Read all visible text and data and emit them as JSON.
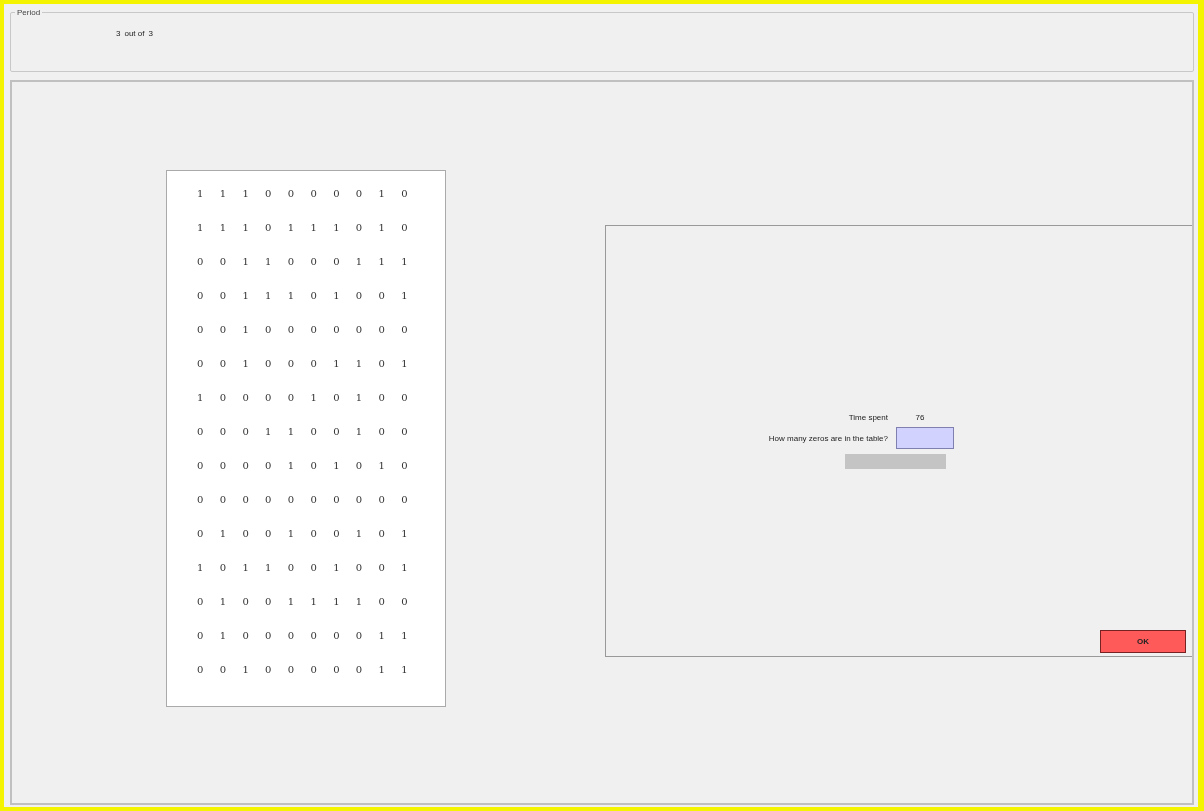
{
  "period": {
    "legend": "Period",
    "current": "3",
    "separator": "out of",
    "total": "3"
  },
  "table": {
    "rows": [
      [
        "1",
        "1",
        "1",
        "0",
        "0",
        "0",
        "0",
        "0",
        "1",
        "0"
      ],
      [
        "1",
        "1",
        "1",
        "0",
        "1",
        "1",
        "1",
        "0",
        "1",
        "0"
      ],
      [
        "0",
        "0",
        "1",
        "1",
        "0",
        "0",
        "0",
        "1",
        "1",
        "1"
      ],
      [
        "0",
        "0",
        "1",
        "1",
        "1",
        "0",
        "1",
        "0",
        "0",
        "1"
      ],
      [
        "0",
        "0",
        "1",
        "0",
        "0",
        "0",
        "0",
        "0",
        "0",
        "0"
      ],
      [
        "0",
        "0",
        "1",
        "0",
        "0",
        "0",
        "1",
        "1",
        "0",
        "1"
      ],
      [
        "1",
        "0",
        "0",
        "0",
        "0",
        "1",
        "0",
        "1",
        "0",
        "0"
      ],
      [
        "0",
        "0",
        "0",
        "1",
        "1",
        "0",
        "0",
        "1",
        "0",
        "0"
      ],
      [
        "0",
        "0",
        "0",
        "0",
        "1",
        "0",
        "1",
        "0",
        "1",
        "0"
      ],
      [
        "0",
        "0",
        "0",
        "0",
        "0",
        "0",
        "0",
        "0",
        "0",
        "0"
      ],
      [
        "0",
        "1",
        "0",
        "0",
        "1",
        "0",
        "0",
        "1",
        "0",
        "1"
      ],
      [
        "1",
        "0",
        "1",
        "1",
        "0",
        "0",
        "1",
        "0",
        "0",
        "1"
      ],
      [
        "0",
        "1",
        "0",
        "0",
        "1",
        "1",
        "1",
        "1",
        "0",
        "0"
      ],
      [
        "0",
        "1",
        "0",
        "0",
        "0",
        "0",
        "0",
        "0",
        "1",
        "1"
      ],
      [
        "0",
        "0",
        "1",
        "0",
        "0",
        "0",
        "0",
        "0",
        "1",
        "1"
      ]
    ]
  },
  "form": {
    "time_label": "Time spent",
    "time_value": "76",
    "question": "How many zeros are in the table?"
  },
  "ok_button": "OK"
}
